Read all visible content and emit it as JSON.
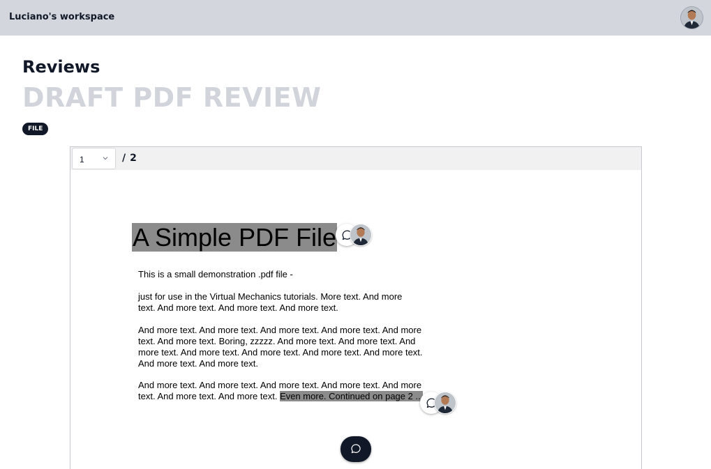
{
  "header": {
    "workspace_name": "Luciano's workspace"
  },
  "page": {
    "title": "Reviews",
    "review_title": "DRAFT PDF REVIEW",
    "badge": "FILE"
  },
  "viewer": {
    "current_page": "1",
    "page_separator": "/",
    "total_pages": "2"
  },
  "document": {
    "heading": "A Simple PDF File",
    "paragraph_1": "This is a small demonstration .pdf file -",
    "paragraph_2_lines": [
      "just for use in the Virtual Mechanics tutorials. More text. And more",
      "text. And more text. And more text. And more text."
    ],
    "paragraph_3_lines": [
      "And more text. And more text. And more text. And more text. And more",
      "text. And more text. Boring, zzzzz. And more text. And more text. And",
      "more text. And more text. And more text. And more text. And more text.",
      "And more text. And more text."
    ],
    "paragraph_4_line_1": "And more text. And more text. And more text. And more text. And more",
    "paragraph_4_line_2_plain": "text. And more text. And more text.",
    "paragraph_4_line_2_highlight": "Even more. Continued on page 2 ..."
  },
  "colors": {
    "topbar_bg": "#d4d6de",
    "highlight": "#8b8b8b",
    "badge_bg": "#111827",
    "review_title": "#d1d5db"
  },
  "icons": {
    "comment": "comment-bubble-icon",
    "chevron": "chevron-down-icon",
    "avatar": "user-avatar"
  }
}
